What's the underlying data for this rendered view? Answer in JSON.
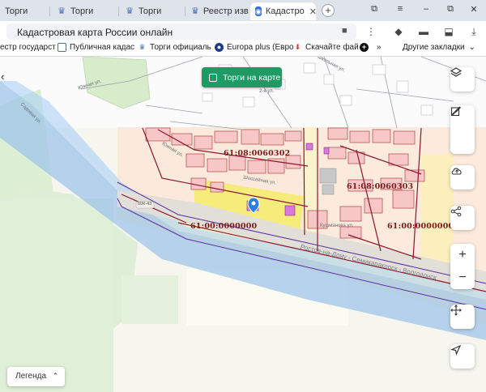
{
  "browser": {
    "tabs": [
      {
        "label": "Торги",
        "icon": "torgi-icon"
      },
      {
        "label": "Торги",
        "icon": "torgi-icon"
      },
      {
        "label": "Торги",
        "icon": "torgi-icon"
      },
      {
        "label": "Реестр изве",
        "icon": "torgi-icon"
      },
      {
        "label": "Кадастро",
        "icon": "cadastre-icon",
        "active": true
      }
    ],
    "address": "Кадастровая карта России онлайн",
    "bookmarks": [
      {
        "label": "естр государст"
      },
      {
        "label": "Публичная кадас"
      },
      {
        "label": "Торги официаль"
      },
      {
        "label": "Europa plus (Евро"
      },
      {
        "label": "Скачайте фай"
      }
    ],
    "other_bookmarks": "Другие закладки"
  },
  "map": {
    "torgi_button": "Торги на карте",
    "legend_label": "Легенда",
    "cadastral_labels": [
      "61:08:0060302",
      "61:08:0060303",
      "61:00:0000000",
      "61:00:0000000"
    ],
    "street_labels": {
      "rostov": "Ростов-на-Дону - Семикаракорск - Волгодонск",
      "yuzhnaya": "Южная ул.",
      "shkolnaya": "Школьная ул.",
      "kushmanova": "Кушманова ул.",
      "sadovaya": "Садовая ул.",
      "vtoraya": "2-я ул.",
      "vpodekin": "Подгорная ул.",
      "shossejnaya": "Шоссейная ул."
    },
    "road_badge": "60К-43",
    "accent_color": "#1f9a64"
  }
}
